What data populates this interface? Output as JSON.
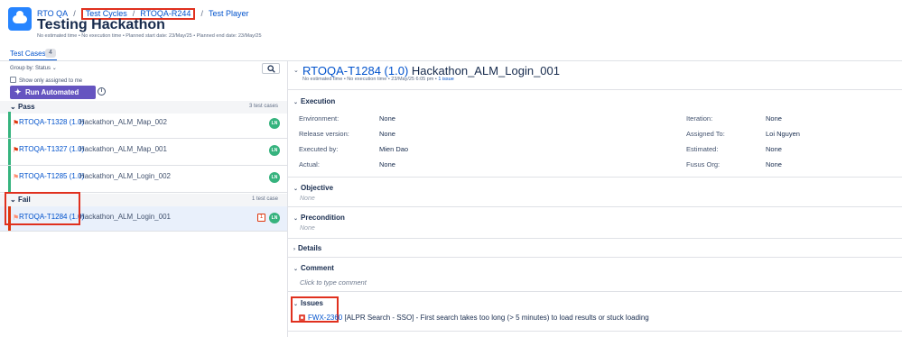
{
  "header": {
    "app_icon": "cloud-icon",
    "breadcrumbs": [
      "RTO QA",
      "Test Cycles",
      "RTOQA-R244",
      "Test Player"
    ],
    "title": "Testing Hackathon",
    "meta": "No estimated time  •  No execution time  •  Planned start date: 23/May/25  •  Planned end date: 23/May/25"
  },
  "tabs": [
    {
      "label": "Test Cases",
      "count": "4"
    }
  ],
  "left": {
    "group_by": "Group by: Status",
    "show_only_label": "Show only assigned to me",
    "run_button": "Run Automated Tests",
    "groups": [
      {
        "name": "Pass",
        "count": "3 test cases",
        "color": "#36b37e",
        "rows": [
          {
            "key": "RTOQA-T1328 (1.0)",
            "title": "Hackathon_ALM_Map_002",
            "avatar": "LN"
          },
          {
            "key": "RTOQA-T1327 (1.0)",
            "title": "Hackathon_ALM_Map_001",
            "avatar": "LN"
          },
          {
            "key": "RTOQA-T1285 (1.0)",
            "title": "Hackathon_ALM_Login_002",
            "avatar": "LN"
          }
        ]
      },
      {
        "name": "Fail",
        "count": "1 test case",
        "color": "#de350b",
        "rows": [
          {
            "key": "RTOQA-T1284 (1.0)",
            "title": "Hackathon_ALM_Login_001",
            "avatar": "LN",
            "issues": "1"
          }
        ]
      }
    ]
  },
  "detail": {
    "key": "RTOQA-T1284 (1.0)",
    "name": "Hackathon_ALM_Login_001",
    "meta": "No estimated time  •  No execution time  •  23/May/25 6:05 pm  •  ",
    "meta_link": "1 issue",
    "sections": {
      "execution": "Execution",
      "objective": "Objective",
      "precondition": "Precondition",
      "details": "Details",
      "comment": "Comment",
      "issues": "Issues"
    },
    "fields_left": [
      {
        "label": "Environment:",
        "value": "None"
      },
      {
        "label": "Release version:",
        "value": "None"
      },
      {
        "label": "Executed by:",
        "value": "Mien Dao"
      },
      {
        "label": "Actual:",
        "value": "None"
      }
    ],
    "fields_right": [
      {
        "label": "Iteration:",
        "value": "None"
      },
      {
        "label": "Assigned To:",
        "value": "Loi Nguyen"
      },
      {
        "label": "Estimated:",
        "value": "None"
      },
      {
        "label": "Fusus Org:",
        "value": "None"
      }
    ],
    "objective_value": "None",
    "precondition_value": "None",
    "comment_placeholder": "Click to type comment",
    "issue": {
      "key": "FWX-2360",
      "summary": "[ALPR Search - SSO] - First search takes too long (> 5 minutes) to load results or stuck loading"
    }
  }
}
